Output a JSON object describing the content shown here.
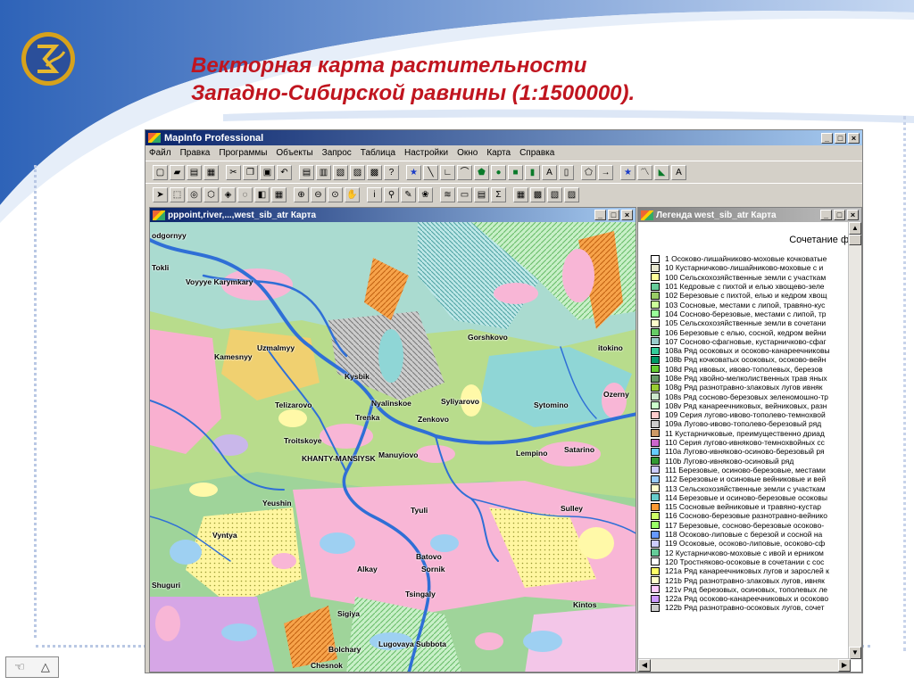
{
  "slide": {
    "title_line1": "Векторная карта растительности",
    "title_line2": "Западно-Сибирской равнины (1:1500000).",
    "nav_left": "☜",
    "nav_right": "△"
  },
  "app": {
    "title": "MapInfo Professional",
    "menu": [
      "Файл",
      "Правка",
      "Программы",
      "Объекты",
      "Запрос",
      "Таблица",
      "Настройки",
      "Окно",
      "Карта",
      "Справка"
    ],
    "window_buttons": [
      "_",
      "□",
      "×"
    ]
  },
  "map_window": {
    "title": "pppoint,river,...,west_sib_atr Карта",
    "places": [
      "odgornyy",
      "Tokli",
      "Voyyye Karymkary",
      "Uzmalmyy",
      "Kamesnyy",
      "Kysbik",
      "Telizarovo",
      "Nyalinskoe",
      "Syliyarovo",
      "Zenkovo",
      "Trenka",
      "Troitskoye",
      "KHANTY-MANSIYSK",
      "Manuyiovo",
      "Lempino",
      "Satarino",
      "Sytomino",
      "Ozerny",
      "Gorshkovo",
      "itokino",
      "Yeushin",
      "Vyntya",
      "Tyuli",
      "Sulley",
      "Batovo",
      "Sornik",
      "Alkay",
      "Tsingaly",
      "Shuguri",
      "Sigiya",
      "Lugovaya Subbota",
      "Bolchary",
      "Chesnok",
      "Kintos"
    ]
  },
  "legend_window": {
    "title": "Легенда west_sib_atr Карта",
    "header": "Сочетание ф",
    "items": [
      {
        "label": "1 Осоково-лишайниково-моховые кочковатые",
        "color": "#ffffff"
      },
      {
        "label": "10 Кустарничково-лишайниково-моховые с и",
        "color": "#e8e8d0"
      },
      {
        "label": "100 Сельскохозяйственные земли с участкам",
        "color": "#ffff99"
      },
      {
        "label": "101 Кедровые с пихтой и елью хвощево-зеле",
        "color": "#66cc99"
      },
      {
        "label": "102 Березовые с пихтой, елью и кедром хвощ",
        "color": "#99cc66"
      },
      {
        "label": "103 Сосновые, местами с липой, травяно-кус",
        "color": "#ccff99"
      },
      {
        "label": "104 Сосново-березовые, местами с липой, тр",
        "color": "#99ff99"
      },
      {
        "label": "105 Сельскохозяйственные земли в сочетани",
        "color": "#ffffcc"
      },
      {
        "label": "106 Березовые с елью, сосной, кедром вейни",
        "color": "#66cc66"
      },
      {
        "label": "107 Сосново-сфагновые, кустарничково-сфаг",
        "color": "#99cccc"
      },
      {
        "label": "108a Ряд осоковых и осоково-канареечниковы",
        "color": "#33cc99"
      },
      {
        "label": "108b Ряд кочковатых осоковых, осоково-вейн",
        "color": "#009966"
      },
      {
        "label": "108d Ряд ивовых, ивово-тополевых, березов",
        "color": "#66cc33"
      },
      {
        "label": "108e Ряд хвойно-мелколиственных трав яных",
        "color": "#669966"
      },
      {
        "label": "108g Ряд разнотравно-злаковых лугов ивняк",
        "color": "#99cc33"
      },
      {
        "label": "108s Ряд сосново-березовых зеленомошно-тр",
        "color": "#cce6cc"
      },
      {
        "label": "108v Ряд канареечниковых, вейниковых, разн",
        "color": "#ccffcc"
      },
      {
        "label": "109 Серия лугово-ивово-тополево-темнохвой",
        "color": "#ffcccc"
      },
      {
        "label": "109a Лугово-ивово-тополево-березовый ряд",
        "color": "#cccccc"
      },
      {
        "label": "11 Кустарничковые, преимущественно дриад",
        "color": "#cc9966"
      },
      {
        "label": "110 Серия лугово-ивняково-темнохвойных сс",
        "color": "#cc66cc"
      },
      {
        "label": "110a Лугово-ивняково-осиново-березовый ря",
        "color": "#66ccff"
      },
      {
        "label": "110b Лугово-ивняково-осиновый ряд",
        "color": "#339933"
      },
      {
        "label": "111 Березовые, осиново-березовые, местами",
        "color": "#ccccff"
      },
      {
        "label": "112 Березовые и осиновые вейниковые и вей",
        "color": "#99ccff"
      },
      {
        "label": "113 Сельскохозяйственные земли с участкам",
        "color": "#ffffcc"
      },
      {
        "label": "114 Березовые и осиново-березовые осоковы",
        "color": "#66cccc"
      },
      {
        "label": "115 Сосновые вейниковые и травяно-кустар",
        "color": "#ff9933"
      },
      {
        "label": "116 Сосново-березовые разнотравно-вейнико",
        "color": "#ccff66"
      },
      {
        "label": "117 Березовые, сосново-березовые осоково-",
        "color": "#99ff66"
      },
      {
        "label": "118 Осоково-липовые с березой и сосной на",
        "color": "#6699ff"
      },
      {
        "label": "119 Осоковые, осоково-липовые, осоково-сф",
        "color": "#ccccff"
      },
      {
        "label": "12 Кустарничково-моховые с ивой и ерником",
        "color": "#66cc99"
      },
      {
        "label": "120 Тростняково-осоковые в сочетании с сос",
        "color": "#ffffff"
      },
      {
        "label": "121a Ряд канареечниковых лугов и зарослей к",
        "color": "#ffff66"
      },
      {
        "label": "121b Ряд разнотравно-злаковых лугов, ивняк",
        "color": "#ffffcc"
      },
      {
        "label": "121v Ряд березовых, осиновых, тополевых ле",
        "color": "#ffccff"
      },
      {
        "label": "122a Ряд осоково-канареечниковых и осоково",
        "color": "#cc99ff"
      },
      {
        "label": "122b Ряд разнотравно-осоковых лугов, сочет",
        "color": "#cccccc"
      }
    ]
  }
}
